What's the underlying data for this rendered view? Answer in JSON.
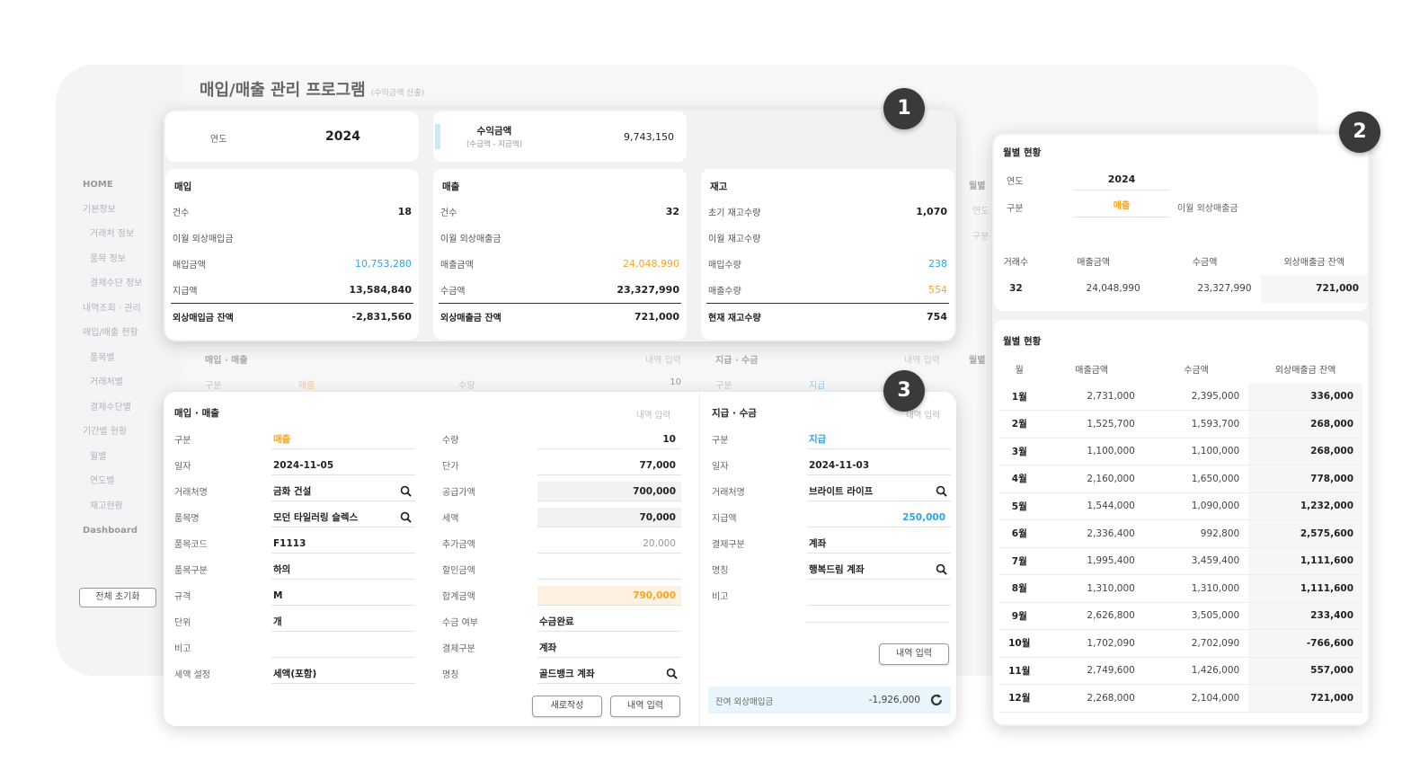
{
  "app": {
    "title": "매입/매출 관리 프로그램",
    "subtitle": "(수익금액 산출)"
  },
  "sidebar": {
    "items": [
      {
        "label": "HOME",
        "type": "top"
      },
      {
        "label": "기본정보",
        "type": "main"
      },
      {
        "label": "거래처 정보",
        "type": "sub"
      },
      {
        "label": "품목 정보",
        "type": "sub"
      },
      {
        "label": "결제수단 정보",
        "type": "sub"
      },
      {
        "label": "내역조회 · 관리",
        "type": "main"
      },
      {
        "label": "매입/매출 현황",
        "type": "main"
      },
      {
        "label": "품목별",
        "type": "sub"
      },
      {
        "label": "거래처별",
        "type": "sub"
      },
      {
        "label": "결제수단별",
        "type": "sub"
      },
      {
        "label": "기간별 현황",
        "type": "main"
      },
      {
        "label": "월별",
        "type": "sub"
      },
      {
        "label": "연도별",
        "type": "sub"
      },
      {
        "label": "재고현황",
        "type": "sub"
      },
      {
        "label": "Dashboard",
        "type": "top"
      }
    ],
    "reset_label": "전체 초기화"
  },
  "badges": {
    "b1": "1",
    "b2": "2",
    "b3": "3"
  },
  "summary": {
    "year_label": "연도",
    "year": "2024",
    "profit_label": "수익금액",
    "profit_note": "(수금액 - 지급액)",
    "profit": "9,743,150",
    "purchase": {
      "title": "매입",
      "rows": [
        {
          "label": "건수",
          "value": "18"
        },
        {
          "label": "이월 외상매입금",
          "value": ""
        },
        {
          "label": "매입금액",
          "value": "10,753,280",
          "color": "blue"
        },
        {
          "label": "지급액",
          "value": "13,584,840"
        }
      ],
      "total_label": "외상매입금 잔액",
      "total": "-2,831,560"
    },
    "sales": {
      "title": "매출",
      "rows": [
        {
          "label": "건수",
          "value": "32"
        },
        {
          "label": "이월 외상매출금",
          "value": ""
        },
        {
          "label": "매출금액",
          "value": "24,048,990",
          "color": "orange"
        },
        {
          "label": "수금액",
          "value": "23,327,990"
        }
      ],
      "total_label": "외상매출금 잔액",
      "total": "721,000"
    },
    "stock": {
      "title": "재고",
      "rows": [
        {
          "label": "초기 재고수량",
          "value": "1,070"
        },
        {
          "label": "이월 재고수량",
          "value": ""
        },
        {
          "label": "매입수량",
          "value": "238",
          "color": "blue"
        },
        {
          "label": "매출수량",
          "value": "554",
          "color": "orange"
        }
      ],
      "total_label": "현재 재고수량",
      "total": "754"
    }
  },
  "ghost": {
    "tx_title": "매입 · 매출",
    "tx_link": "내역 입력",
    "tx_kind_label": "구분",
    "tx_kind": "매출",
    "tx_qty_label": "수량",
    "tx_qty": "10",
    "pay_title": "지급 · 수금",
    "pay_link": "내역 입력",
    "pay_kind_label": "구분",
    "pay_kind": "지급",
    "monthly1": "월별",
    "monthly2": "월별",
    "year_l": "연도",
    "kind_l": "구분"
  },
  "transaction": {
    "title": "매입 · 매출",
    "link": "내역 입력",
    "left": [
      {
        "label": "구분",
        "value": "매출",
        "color": "orange"
      },
      {
        "label": "일자",
        "value": "2024-11-05"
      },
      {
        "label": "거래처명",
        "value": "금화 건설",
        "search": true
      },
      {
        "label": "품목명",
        "value": "모던 타일러링 슬렉스",
        "search": true
      },
      {
        "label": "품목코드",
        "value": "F1113"
      },
      {
        "label": "품목구분",
        "value": "하의"
      },
      {
        "label": "규격",
        "value": "M"
      },
      {
        "label": "단위",
        "value": "개"
      },
      {
        "label": "비고",
        "value": ""
      },
      {
        "label": "세액 설정",
        "value": "세액(포함)"
      }
    ],
    "right": [
      {
        "label": "수량",
        "value": "10",
        "align": "num"
      },
      {
        "label": "단가",
        "value": "77,000",
        "align": "num"
      },
      {
        "label": "공급가액",
        "value": "700,000",
        "align": "num",
        "bg": "shade"
      },
      {
        "label": "세액",
        "value": "70,000",
        "align": "num",
        "bg": "shade"
      },
      {
        "label": "추가금액",
        "value": "20,000",
        "align": "num",
        "muted": true
      },
      {
        "label": "할인금액",
        "value": "",
        "align": "num"
      },
      {
        "label": "합계금액",
        "value": "790,000",
        "align": "num",
        "bg": "peach",
        "color": "orange"
      },
      {
        "label": "수금 여부",
        "value": "수금완료"
      },
      {
        "label": "결제구분",
        "value": "계좌"
      },
      {
        "label": "명칭",
        "value": "골드뱅크 계좌",
        "search": true
      }
    ],
    "new_button": "새로작성",
    "submit_button": "내역 입력"
  },
  "payment": {
    "title": "지급 · 수금",
    "link": "내역 입력",
    "rows": [
      {
        "label": "구분",
        "value": "지급",
        "color": "blue"
      },
      {
        "label": "일자",
        "value": "2024-11-03"
      },
      {
        "label": "거래처명",
        "value": "브라이트 라이프",
        "search": true
      },
      {
        "label": "지급액",
        "value": "250,000",
        "color": "blue",
        "align": "num"
      },
      {
        "label": "결제구분",
        "value": "계좌"
      },
      {
        "label": "명칭",
        "value": "행복드림 계좌",
        "search": true
      },
      {
        "label": "비고",
        "value": ""
      }
    ],
    "submit_button": "내역 입력",
    "balance_label": "잔여 외상매입금",
    "balance": "-1,926,000"
  },
  "monthly": {
    "title": "월별 현황",
    "year_label": "연도",
    "year": "2024",
    "kind_label": "구분",
    "kind": "매출",
    "carry_label": "이월 외상매출금",
    "summary_headers": [
      "거래수",
      "매출금액",
      "수금액",
      "외상매출금 잔액"
    ],
    "summary_values": [
      "32",
      "24,048,990",
      "23,327,990",
      "721,000"
    ],
    "table_title": "월별 현황",
    "headers": [
      "월",
      "매출금액",
      "수금액",
      "외상매출금 잔액"
    ],
    "rows": [
      [
        "1월",
        "2,731,000",
        "2,395,000",
        "336,000"
      ],
      [
        "2월",
        "1,525,700",
        "1,593,700",
        "268,000"
      ],
      [
        "3월",
        "1,100,000",
        "1,100,000",
        "268,000"
      ],
      [
        "4월",
        "2,160,000",
        "1,650,000",
        "778,000"
      ],
      [
        "5월",
        "1,544,000",
        "1,090,000",
        "1,232,000"
      ],
      [
        "6월",
        "2,336,400",
        "992,800",
        "2,575,600"
      ],
      [
        "7월",
        "1,995,400",
        "3,459,400",
        "1,111,600"
      ],
      [
        "8월",
        "1,310,000",
        "1,310,000",
        "1,111,600"
      ],
      [
        "9월",
        "2,626,800",
        "3,505,000",
        "233,400"
      ],
      [
        "10월",
        "1,702,090",
        "2,702,090",
        "-766,600"
      ],
      [
        "11월",
        "2,749,600",
        "1,426,000",
        "557,000"
      ],
      [
        "12월",
        "2,268,000",
        "2,104,000",
        "721,000"
      ]
    ]
  },
  "colors": {
    "blue": "#2aa6e8",
    "orange": "#f5a623",
    "badge": "#3a3a3a"
  }
}
